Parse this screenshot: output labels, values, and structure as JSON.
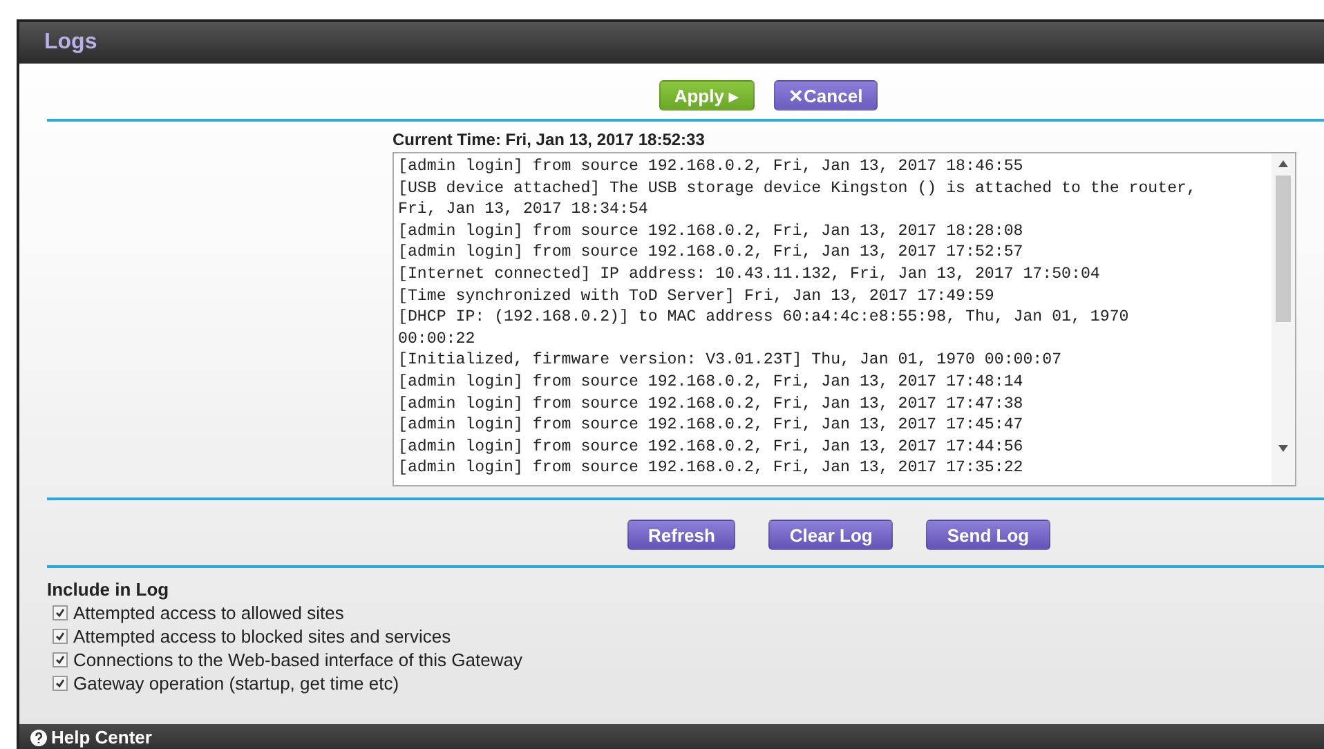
{
  "header": {
    "title": "Logs"
  },
  "actions": [
    {
      "label": "Apply ▸",
      "kind": "apply"
    },
    {
      "label": "✕Cancel",
      "kind": "cancel"
    }
  ],
  "current_time": "Current Time: Fri, Jan 13, 2017 18:52:33",
  "log_lines": [
    "[admin login] from source 192.168.0.2, Fri, Jan 13, 2017 18:46:55",
    "[USB device attached] The USB storage device Kingston () is attached to the router,",
    "Fri, Jan 13, 2017 18:34:54",
    "[admin login] from source 192.168.0.2, Fri, Jan 13, 2017 18:28:08",
    "[admin login] from source 192.168.0.2, Fri, Jan 13, 2017 17:52:57",
    "[Internet connected] IP address: 10.43.11.132, Fri, Jan 13, 2017 17:50:04",
    "[Time synchronized with ToD Server] Fri, Jan 13, 2017 17:49:59",
    "[DHCP IP: (192.168.0.2)] to MAC address 60:a4:4c:e8:55:98, Thu, Jan 01, 1970",
    "00:00:22",
    "[Initialized, firmware version: V3.01.23T] Thu, Jan 01, 1970 00:00:07",
    "[admin login] from source 192.168.0.2, Fri, Jan 13, 2017 17:48:14",
    "[admin login] from source 192.168.0.2, Fri, Jan 13, 2017 17:47:38",
    "[admin login] from source 192.168.0.2, Fri, Jan 13, 2017 17:45:47",
    "[admin login] from source 192.168.0.2, Fri, Jan 13, 2017 17:44:56",
    "[admin login] from source 192.168.0.2, Fri, Jan 13, 2017 17:35:22"
  ],
  "log_buttons": [
    "Refresh",
    "Clear Log",
    "Send Log"
  ],
  "include_in_log": {
    "title": "Include in Log",
    "options": [
      {
        "label": "Attempted access to allowed sites",
        "checked": true
      },
      {
        "label": "Attempted access to blocked sites and services",
        "checked": true
      },
      {
        "label": "Connections to the Web-based interface of this Gateway",
        "checked": true
      },
      {
        "label": "Gateway operation (startup, get time etc)",
        "checked": true
      }
    ]
  },
  "footer": {
    "label": "Help Center"
  }
}
